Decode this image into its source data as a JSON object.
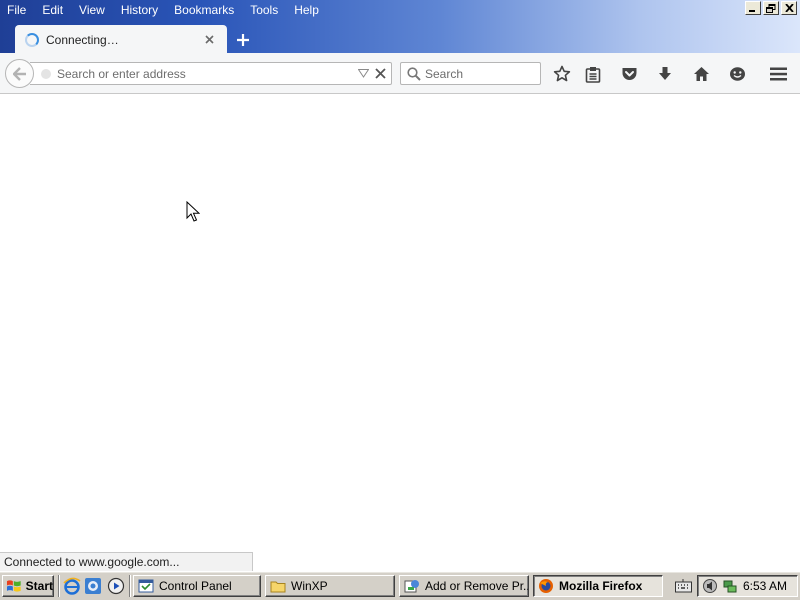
{
  "menu": {
    "items": [
      {
        "label": "File"
      },
      {
        "label": "Edit"
      },
      {
        "label": "View"
      },
      {
        "label": "History"
      },
      {
        "label": "Bookmarks"
      },
      {
        "label": "Tools"
      },
      {
        "label": "Help"
      }
    ]
  },
  "tab": {
    "title": "Connecting…",
    "state": "loading"
  },
  "navbar": {
    "url_placeholder": "Search or enter address",
    "url_value": "",
    "search_placeholder": "Search",
    "buttons": [
      "back-icon",
      "star-icon",
      "reading-list-icon",
      "pocket-icon",
      "download-icon",
      "home-icon",
      "smiley-icon",
      "hamburger-menu-icon"
    ]
  },
  "status": {
    "text": "Connected to www.google.com..."
  },
  "taskbar": {
    "start_label": "Start",
    "quick_launch": [
      "internet-explorer-icon",
      "firefox-icon",
      "media-player-icon"
    ],
    "tasks": [
      {
        "label": "Control Panel",
        "active": false
      },
      {
        "label": "WinXP",
        "active": false
      },
      {
        "label": "Add or Remove Pr...",
        "active": false
      },
      {
        "label": "Mozilla Firefox",
        "active": true
      }
    ],
    "clock": "6:53 AM"
  },
  "colors": {
    "titlebar_start": "#1f3f96",
    "titlebar_end": "#dbe6fb",
    "toolbar_bg": "#f5f6f7",
    "taskbar_bg": "#d4d0c8",
    "spinner": "#3a8fe0"
  }
}
